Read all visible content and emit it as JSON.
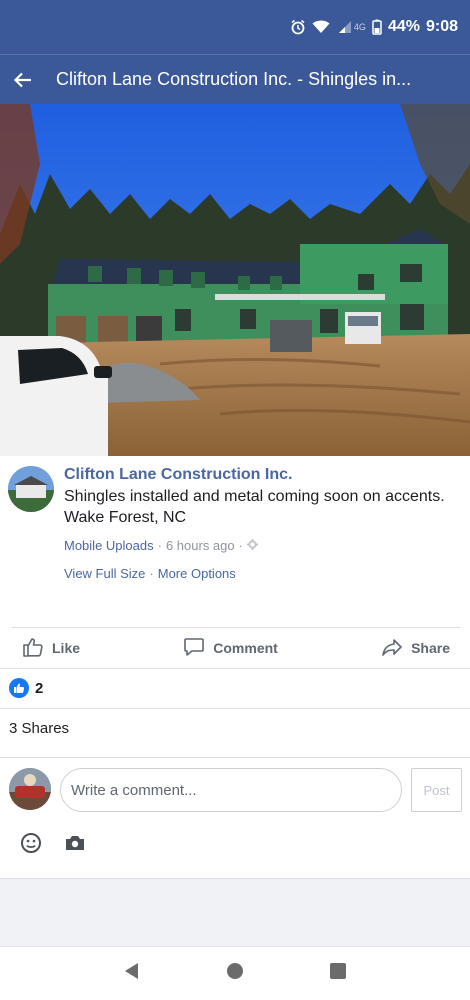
{
  "status_bar": {
    "network": "4G",
    "battery": "44%",
    "time": "9:08",
    "icons": [
      "alarm-icon",
      "wifi-icon",
      "signal-icon",
      "battery-icon"
    ]
  },
  "app_bar": {
    "title": "Clifton Lane Construction Inc. - Shingles in...",
    "back_icon": "back-arrow-icon"
  },
  "post": {
    "page_name": "Clifton Lane Construction Inc.",
    "caption_line1": "Shingles installed and metal coming soon on accents.",
    "caption_line2": "Wake Forest, NC",
    "album": "Mobile Uploads",
    "time": "6 hours ago",
    "privacy_icon": "public-gear-icon",
    "view_full_size": "View Full Size",
    "more_options": "More Options",
    "separator": "·"
  },
  "actions": {
    "like": "Like",
    "comment": "Comment",
    "share": "Share"
  },
  "reactions": {
    "like_count": "2"
  },
  "shares_text": "3 Shares",
  "comment_box": {
    "placeholder": "Write a comment...",
    "post_label": "Post"
  },
  "colors": {
    "header": "#3b5998",
    "link": "#4b67a1",
    "like_blue": "#1877f2"
  }
}
